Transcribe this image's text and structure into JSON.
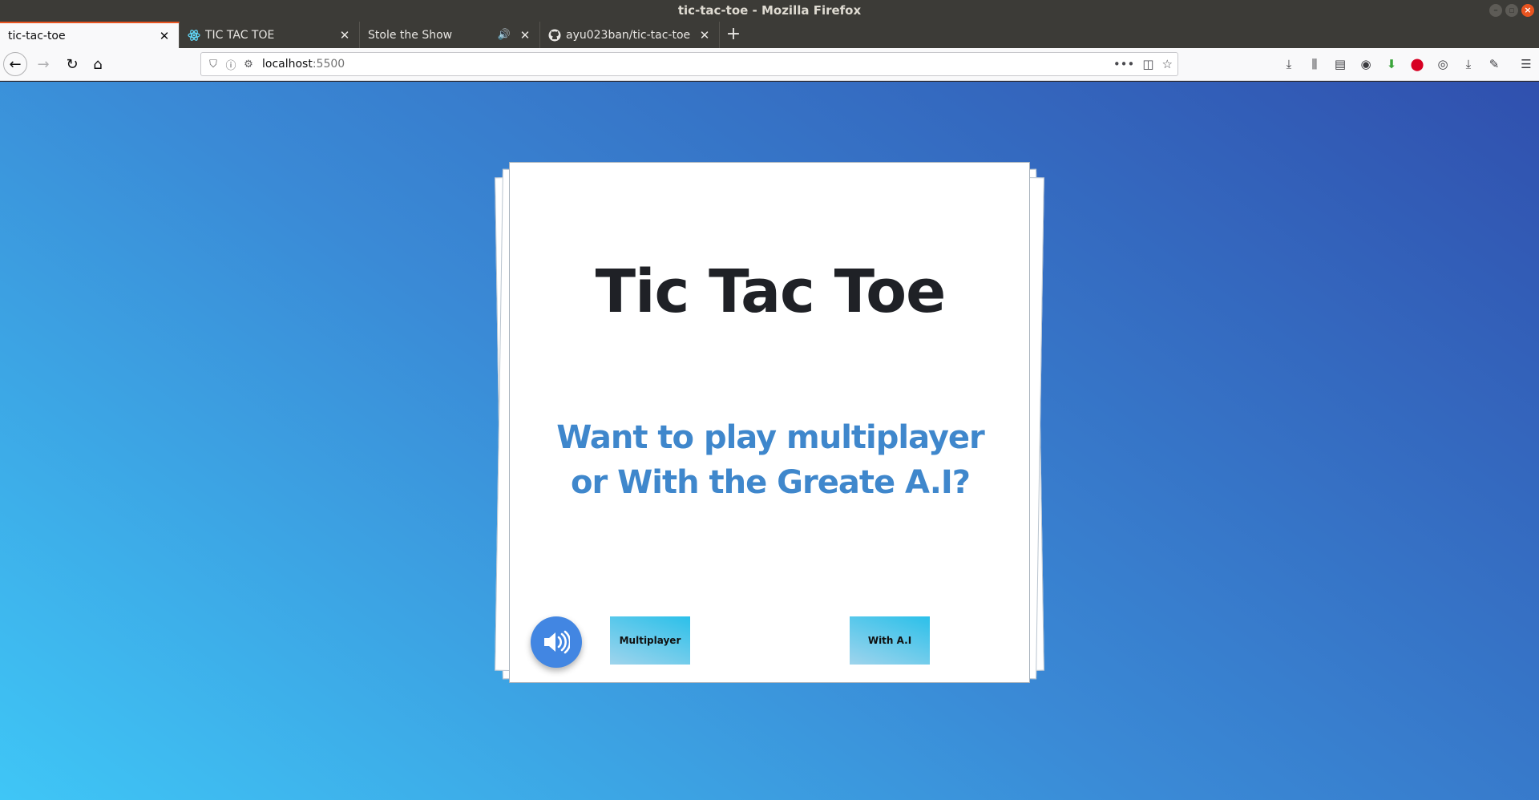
{
  "window": {
    "title": "tic-tac-toe - Mozilla Firefox"
  },
  "tabs": [
    {
      "label": "tic-tac-toe",
      "active": true,
      "icon": "none"
    },
    {
      "label": "TIC TAC TOE",
      "active": false,
      "icon": "react-icon"
    },
    {
      "label": "Stole the Show",
      "active": false,
      "icon": "none",
      "audio": true
    },
    {
      "label": "ayu023ban/tic-tac-toe",
      "active": false,
      "icon": "github-icon"
    }
  ],
  "urlbar": {
    "host": "localhost",
    "port": ":5500"
  },
  "game": {
    "title": "Tic Tac Toe",
    "question": "Want to play multiplayer or With the Greate A.I?",
    "buttons": {
      "multiplayer": "Multiplayer",
      "ai": "With A.I"
    }
  },
  "colors": {
    "accent": "#e95420",
    "question": "#3f87cc",
    "sound_button": "#4286e2"
  }
}
